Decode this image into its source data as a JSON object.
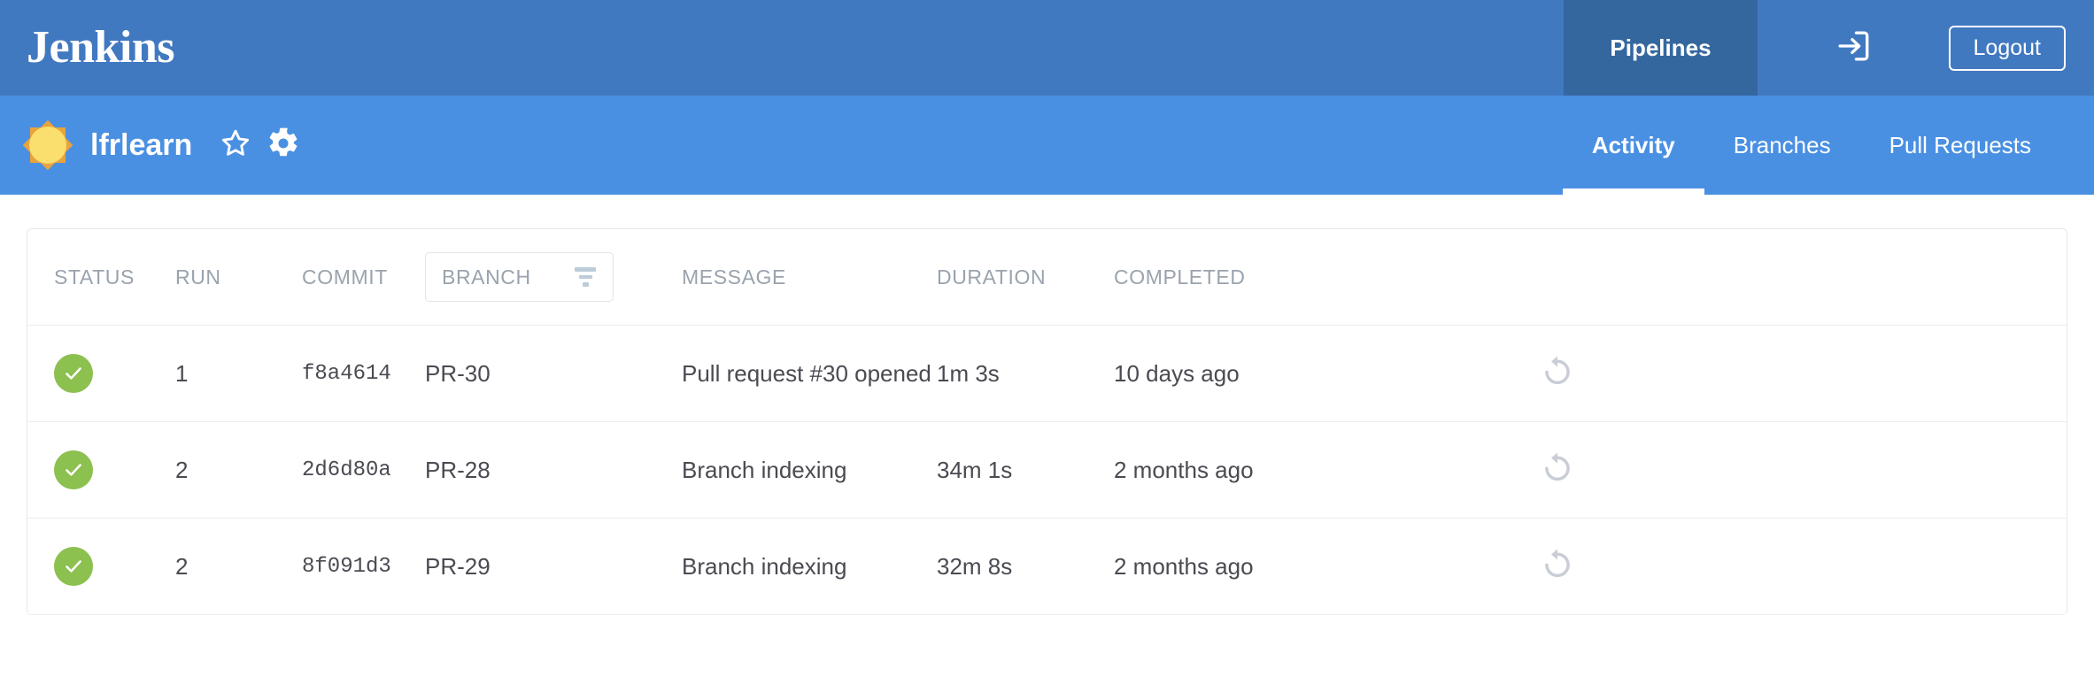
{
  "colors": {
    "topbar_bg": "#4179c1",
    "active_nav_bg": "#35679f",
    "project_bar_bg": "#4a90e2",
    "status_success": "#8cc04f",
    "header_text": "#9aa3ad",
    "body_text": "#4a4a52",
    "border": "#e9edf1",
    "replay_icon": "#c9ced6",
    "weather_sun": "#fadf6e",
    "weather_rays": "#e8a33d"
  },
  "topbar": {
    "brand": "Jenkins",
    "nav": [
      {
        "label": "Pipelines",
        "active": true
      }
    ],
    "exit_icon": "exit-to-app-icon",
    "logout_label": "Logout"
  },
  "project_header": {
    "health_icon": "weather-sunny-icon",
    "name": "lfrlearn",
    "favorite_icon": "star-outline-icon",
    "settings_icon": "gear-icon",
    "tabs": [
      {
        "label": "Activity",
        "active": true
      },
      {
        "label": "Branches",
        "active": false
      },
      {
        "label": "Pull Requests",
        "active": false
      }
    ]
  },
  "table": {
    "columns": {
      "status": "STATUS",
      "run": "RUN",
      "commit": "COMMIT",
      "branch": "BRANCH",
      "message": "MESSAGE",
      "duration": "DURATION",
      "completed": "COMPLETED"
    },
    "branch_filter": {
      "label": "BRANCH",
      "icon": "filter-funnel-icon"
    },
    "rows": [
      {
        "status": "success",
        "status_icon": "check-circle-icon",
        "run": "1",
        "commit": "f8a4614",
        "branch": "PR-30",
        "message": "Pull request #30 opened",
        "duration": "1m 3s",
        "completed": "10 days ago",
        "action_icon": "replay-icon"
      },
      {
        "status": "success",
        "status_icon": "check-circle-icon",
        "run": "2",
        "commit": "2d6d80a",
        "branch": "PR-28",
        "message": "Branch indexing",
        "duration": "34m 1s",
        "completed": "2 months ago",
        "action_icon": "replay-icon"
      },
      {
        "status": "success",
        "status_icon": "check-circle-icon",
        "run": "2",
        "commit": "8f091d3",
        "branch": "PR-29",
        "message": "Branch indexing",
        "duration": "32m 8s",
        "completed": "2 months ago",
        "action_icon": "replay-icon"
      }
    ]
  }
}
